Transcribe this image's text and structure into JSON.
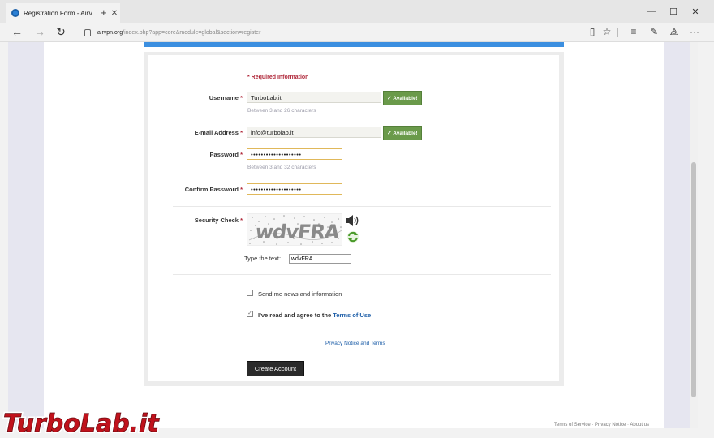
{
  "browser": {
    "tab_title": "Registration Form - AirV",
    "tab_close": "✕",
    "new_tab": "+",
    "minimize": "—",
    "maximize": "☐",
    "close": "✕",
    "url_domain": "airvpn.org",
    "url_path": "/index.php?app=core&module=global&section=register"
  },
  "form": {
    "required_note": "* Required Information",
    "username_label": "Username",
    "username_value": "TurboLab.it",
    "username_hint": "Between 3 and 26 characters",
    "available_label": "✓ Available!",
    "email_label": "E-mail Address",
    "email_value": "info@turbolab.it",
    "password_label": "Password",
    "password_value": "••••••••••••••••••••",
    "password_hint": "Between 3 and 32 characters",
    "confirm_label": "Confirm Password",
    "confirm_value": "••••••••••••••••••••",
    "security_label": "Security Check",
    "star": "*",
    "captcha_text": "wdvFRA",
    "type_text_label": "Type the text:",
    "captcha_input_value": "wdvFRA",
    "news_label": "Send me news and information",
    "agree_label_prefix": "I've read and agree to the ",
    "agree_link": "Terms of Use",
    "privacy_link": "Privacy Notice and Terms",
    "create_button": "Create Account"
  },
  "footer": {
    "links": "Terms of Service · Privacy Notice · About us"
  },
  "watermark": {
    "text": "TurboLab.it"
  },
  "colors": {
    "accent_blue": "#3c8fe0",
    "required_red": "#b0283a",
    "available_green": "#6a9a4a",
    "link_blue": "#1d5ea8"
  }
}
